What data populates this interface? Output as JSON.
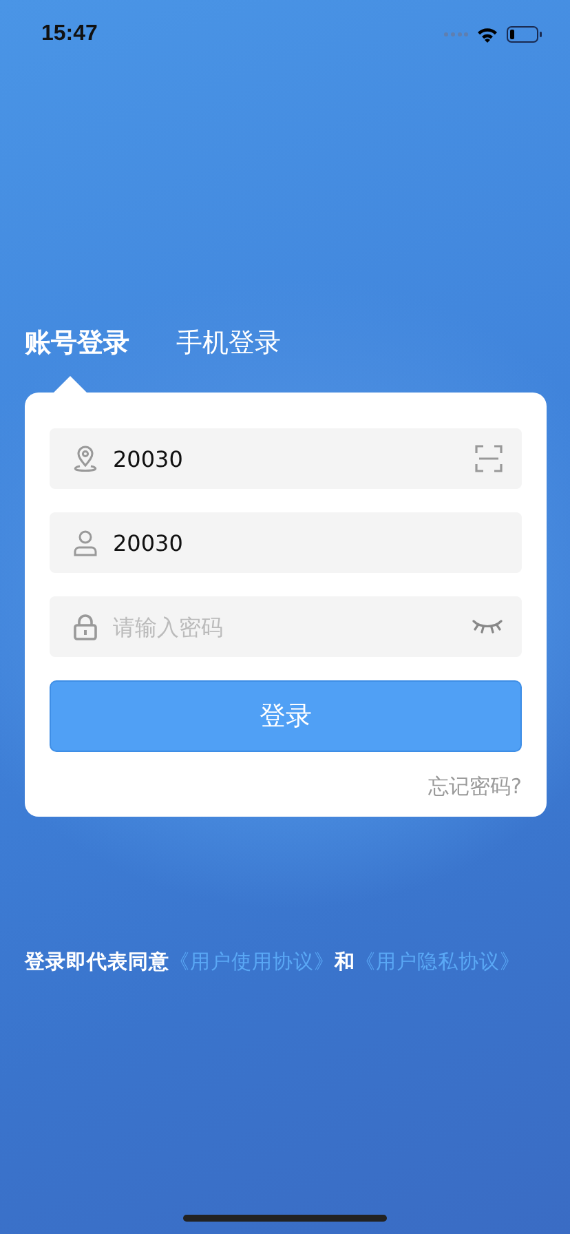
{
  "status_bar": {
    "time": "15:47"
  },
  "tabs": [
    {
      "label": "账号登录",
      "selected": true
    },
    {
      "label": "手机登录",
      "selected": false
    }
  ],
  "fields": [
    {
      "kind": "site",
      "value": "20030"
    },
    {
      "kind": "account",
      "value": "20030"
    },
    {
      "kind": "password",
      "placeholder": "请输入密码"
    }
  ],
  "login_button": "登录",
  "forgot_link": "忘记密码?",
  "agreement": {
    "text": "登录即代表同意",
    "link_1": "《用户使用协议》",
    "joiner": "和",
    "link_2": "《用户隐私协议》"
  }
}
